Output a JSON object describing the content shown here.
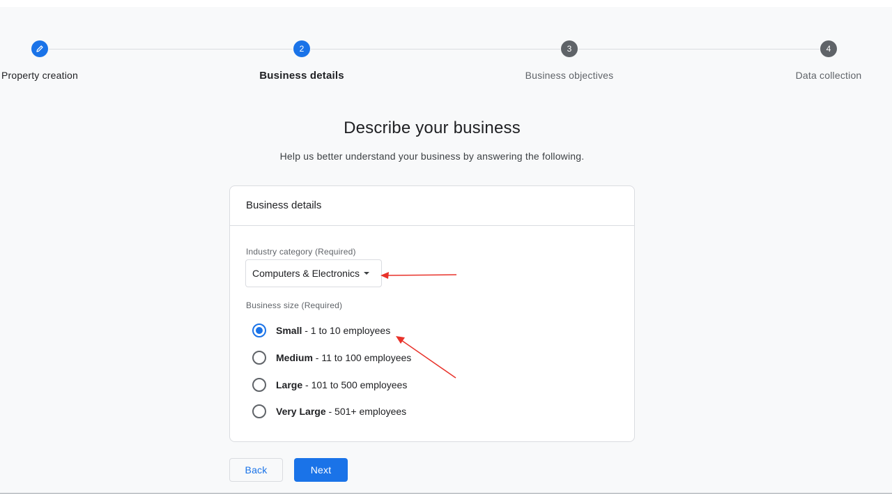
{
  "stepper": {
    "steps": [
      {
        "number": "",
        "label": "Property creation",
        "state": "done",
        "icon": "pencil-icon"
      },
      {
        "number": "2",
        "label": "Business details",
        "state": "current"
      },
      {
        "number": "3",
        "label": "Business objectives",
        "state": "todo"
      },
      {
        "number": "4",
        "label": "Data collection",
        "state": "todo"
      }
    ]
  },
  "main": {
    "title": "Describe your business",
    "subtitle": "Help us better understand your business by answering the following."
  },
  "card": {
    "header": "Business details",
    "industry": {
      "label": "Industry category (Required)",
      "value": "Computers & Electronics"
    },
    "size": {
      "label": "Business size (Required)",
      "options": [
        {
          "bold": "Small",
          "rest": " - 1 to 10 employees",
          "checked": true
        },
        {
          "bold": "Medium",
          "rest": " - 11 to 100 employees",
          "checked": false
        },
        {
          "bold": "Large",
          "rest": " - 101 to 500 employees",
          "checked": false
        },
        {
          "bold": "Very Large",
          "rest": " - 501+ employees",
          "checked": false
        }
      ]
    }
  },
  "buttons": {
    "back": "Back",
    "next": "Next"
  },
  "colors": {
    "accent": "#1a73e8",
    "annotation": "#e8322a"
  }
}
